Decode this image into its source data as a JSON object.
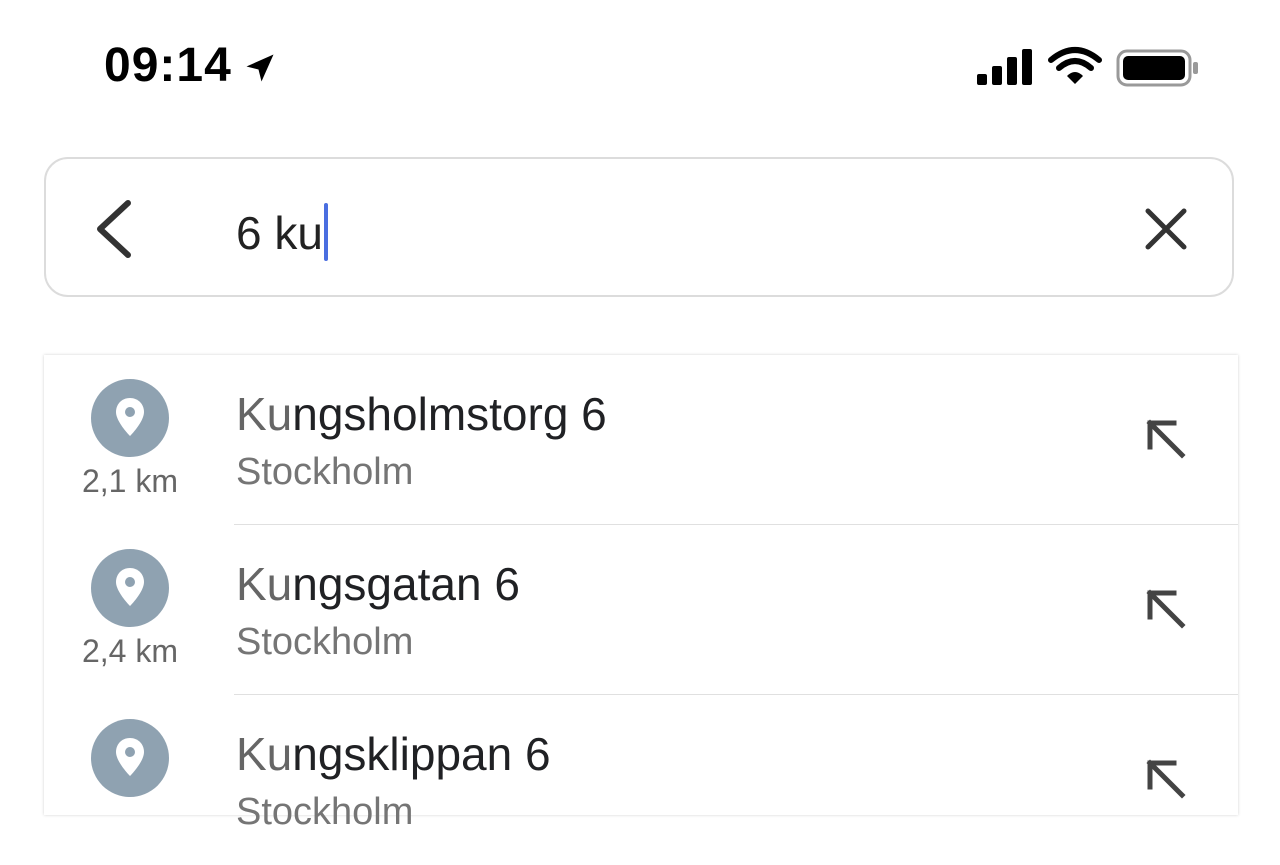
{
  "status_bar": {
    "time": "09:14",
    "location_icon": "location-arrow-icon",
    "signal_icon": "cellular-signal-icon",
    "wifi_icon": "wifi-icon",
    "battery_icon": "battery-icon"
  },
  "search": {
    "back_icon": "chevron-left-icon",
    "query": "6 ku",
    "clear_icon": "close-icon",
    "caret_color": "#4a6ee0"
  },
  "results": [
    {
      "match": "Ku",
      "rest": "ngsholmstorg 6",
      "subtitle": "Stockholm",
      "distance": "2,1 km"
    },
    {
      "match": "Ku",
      "rest": "ngsgatan 6",
      "subtitle": "Stockholm",
      "distance": "2,4 km"
    },
    {
      "match": "Ku",
      "rest": "ngsklippan 6",
      "subtitle": "Stockholm",
      "distance": ""
    }
  ],
  "colors": {
    "pin_circle": "#8fa2b1",
    "text_primary": "#202124",
    "text_secondary": "#757575"
  }
}
